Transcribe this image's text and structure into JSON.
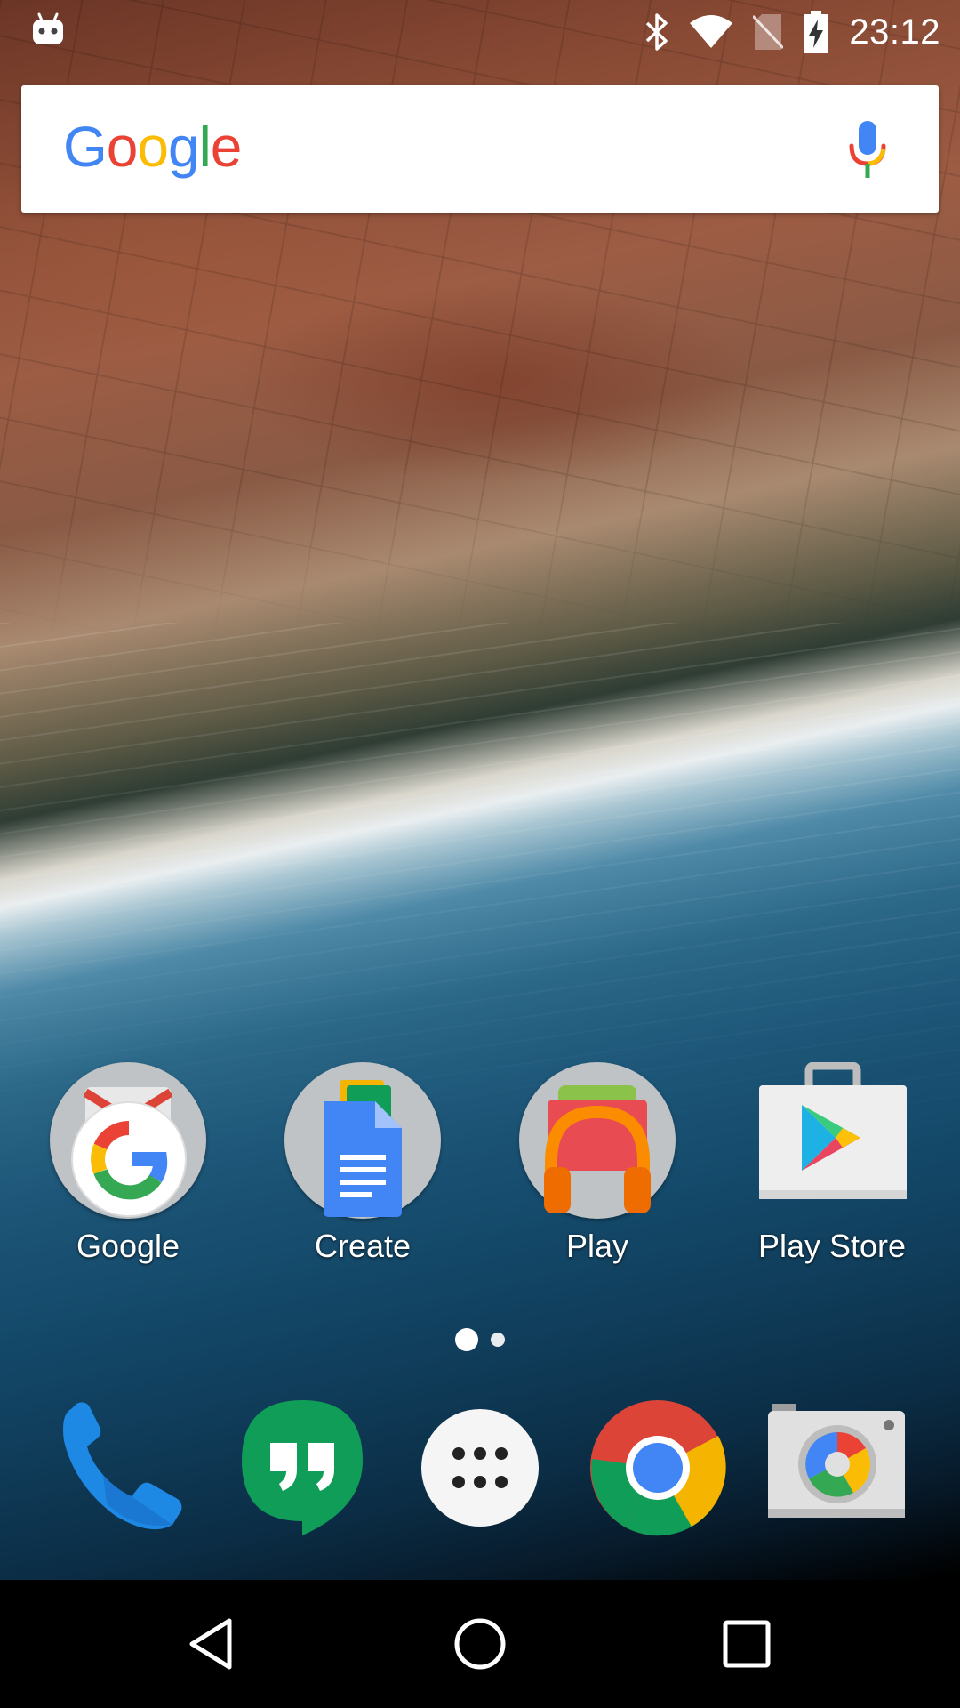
{
  "status_bar": {
    "time": "23:12",
    "icons": [
      "android-robot-icon",
      "bluetooth-icon",
      "wifi-icon",
      "no-sim-icon",
      "battery-charging-icon"
    ]
  },
  "search_bar": {
    "logo_letters": [
      {
        "char": "G",
        "color": "#4285F4"
      },
      {
        "char": "o",
        "color": "#EA4335"
      },
      {
        "char": "o",
        "color": "#FBBC05"
      },
      {
        "char": "g",
        "color": "#4285F4"
      },
      {
        "char": "l",
        "color": "#34A853"
      },
      {
        "char": "e",
        "color": "#EA4335"
      }
    ],
    "mic_icon": "mic-icon"
  },
  "home_apps": [
    {
      "label": "Google",
      "icon": "google-folder-icon"
    },
    {
      "label": "Create",
      "icon": "create-folder-icon"
    },
    {
      "label": "Play",
      "icon": "play-folder-icon"
    },
    {
      "label": "Play Store",
      "icon": "play-store-icon"
    }
  ],
  "page_indicator": {
    "pages": 2,
    "current": 1
  },
  "dock": [
    {
      "name": "Phone",
      "icon": "phone-icon"
    },
    {
      "name": "Hangouts",
      "icon": "hangouts-icon"
    },
    {
      "name": "Apps",
      "icon": "app-drawer-icon"
    },
    {
      "name": "Chrome",
      "icon": "chrome-icon"
    },
    {
      "name": "Camera",
      "icon": "camera-icon"
    }
  ],
  "nav_bar": {
    "buttons": [
      "back-icon",
      "home-icon",
      "recents-icon"
    ]
  },
  "colors": {
    "google_blue": "#4285F4",
    "google_red": "#EA4335",
    "google_yellow": "#FBBC05",
    "google_green": "#34A853"
  }
}
